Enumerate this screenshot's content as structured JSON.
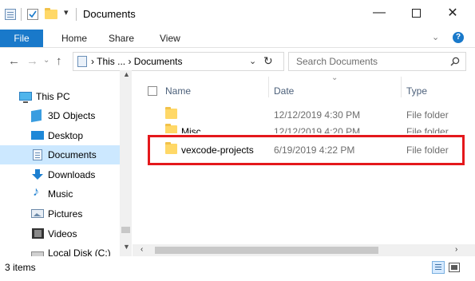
{
  "titlebar": {
    "dropdown_glyph": "▾",
    "title": "Documents",
    "minimize": "—",
    "close": "✕"
  },
  "ribbon": {
    "tabs": [
      "File",
      "Home",
      "Share",
      "View"
    ],
    "expand": "⌄",
    "help": "?"
  },
  "address": {
    "back": "←",
    "forward": "→",
    "recent": "⌄",
    "up": "↑",
    "path": "› This ... › Documents",
    "chevron": "⌄",
    "refresh": "↻",
    "search_placeholder": "Search Documents"
  },
  "navpane": {
    "items": [
      {
        "label": "This PC",
        "icon": "computer-icon"
      },
      {
        "label": "3D Objects",
        "icon": "3d-objects-icon"
      },
      {
        "label": "Desktop",
        "icon": "desktop-icon"
      },
      {
        "label": "Documents",
        "icon": "documents-icon",
        "selected": true
      },
      {
        "label": "Downloads",
        "icon": "download-icon"
      },
      {
        "label": "Music",
        "icon": "music-icon"
      },
      {
        "label": "Pictures",
        "icon": "pictures-icon"
      },
      {
        "label": "Videos",
        "icon": "videos-icon"
      },
      {
        "label": "Local Disk (C:)",
        "icon": "disk-icon"
      }
    ],
    "scroll_up": "▲",
    "scroll_down": "▼"
  },
  "content": {
    "headers": {
      "name": "Name",
      "date": "Date",
      "type": "Type",
      "sort_glyph": "⌄"
    },
    "rows": [
      {
        "name": "",
        "date": "12/12/2019 4:30 PM",
        "type": "File folder"
      },
      {
        "name": "Misc",
        "date": "12/12/2019 4:20 PM",
        "type": "File folder"
      },
      {
        "name": "vexcode-projects",
        "date": "6/19/2019 4:22 PM",
        "type": "File folder"
      }
    ],
    "scroll_left": "‹",
    "scroll_right": "›"
  },
  "status": {
    "count": "3 items"
  },
  "colors": {
    "accent": "#1979ca",
    "selection": "#cce8ff",
    "highlight_box": "#e4181c",
    "folder": "#ffd867"
  }
}
